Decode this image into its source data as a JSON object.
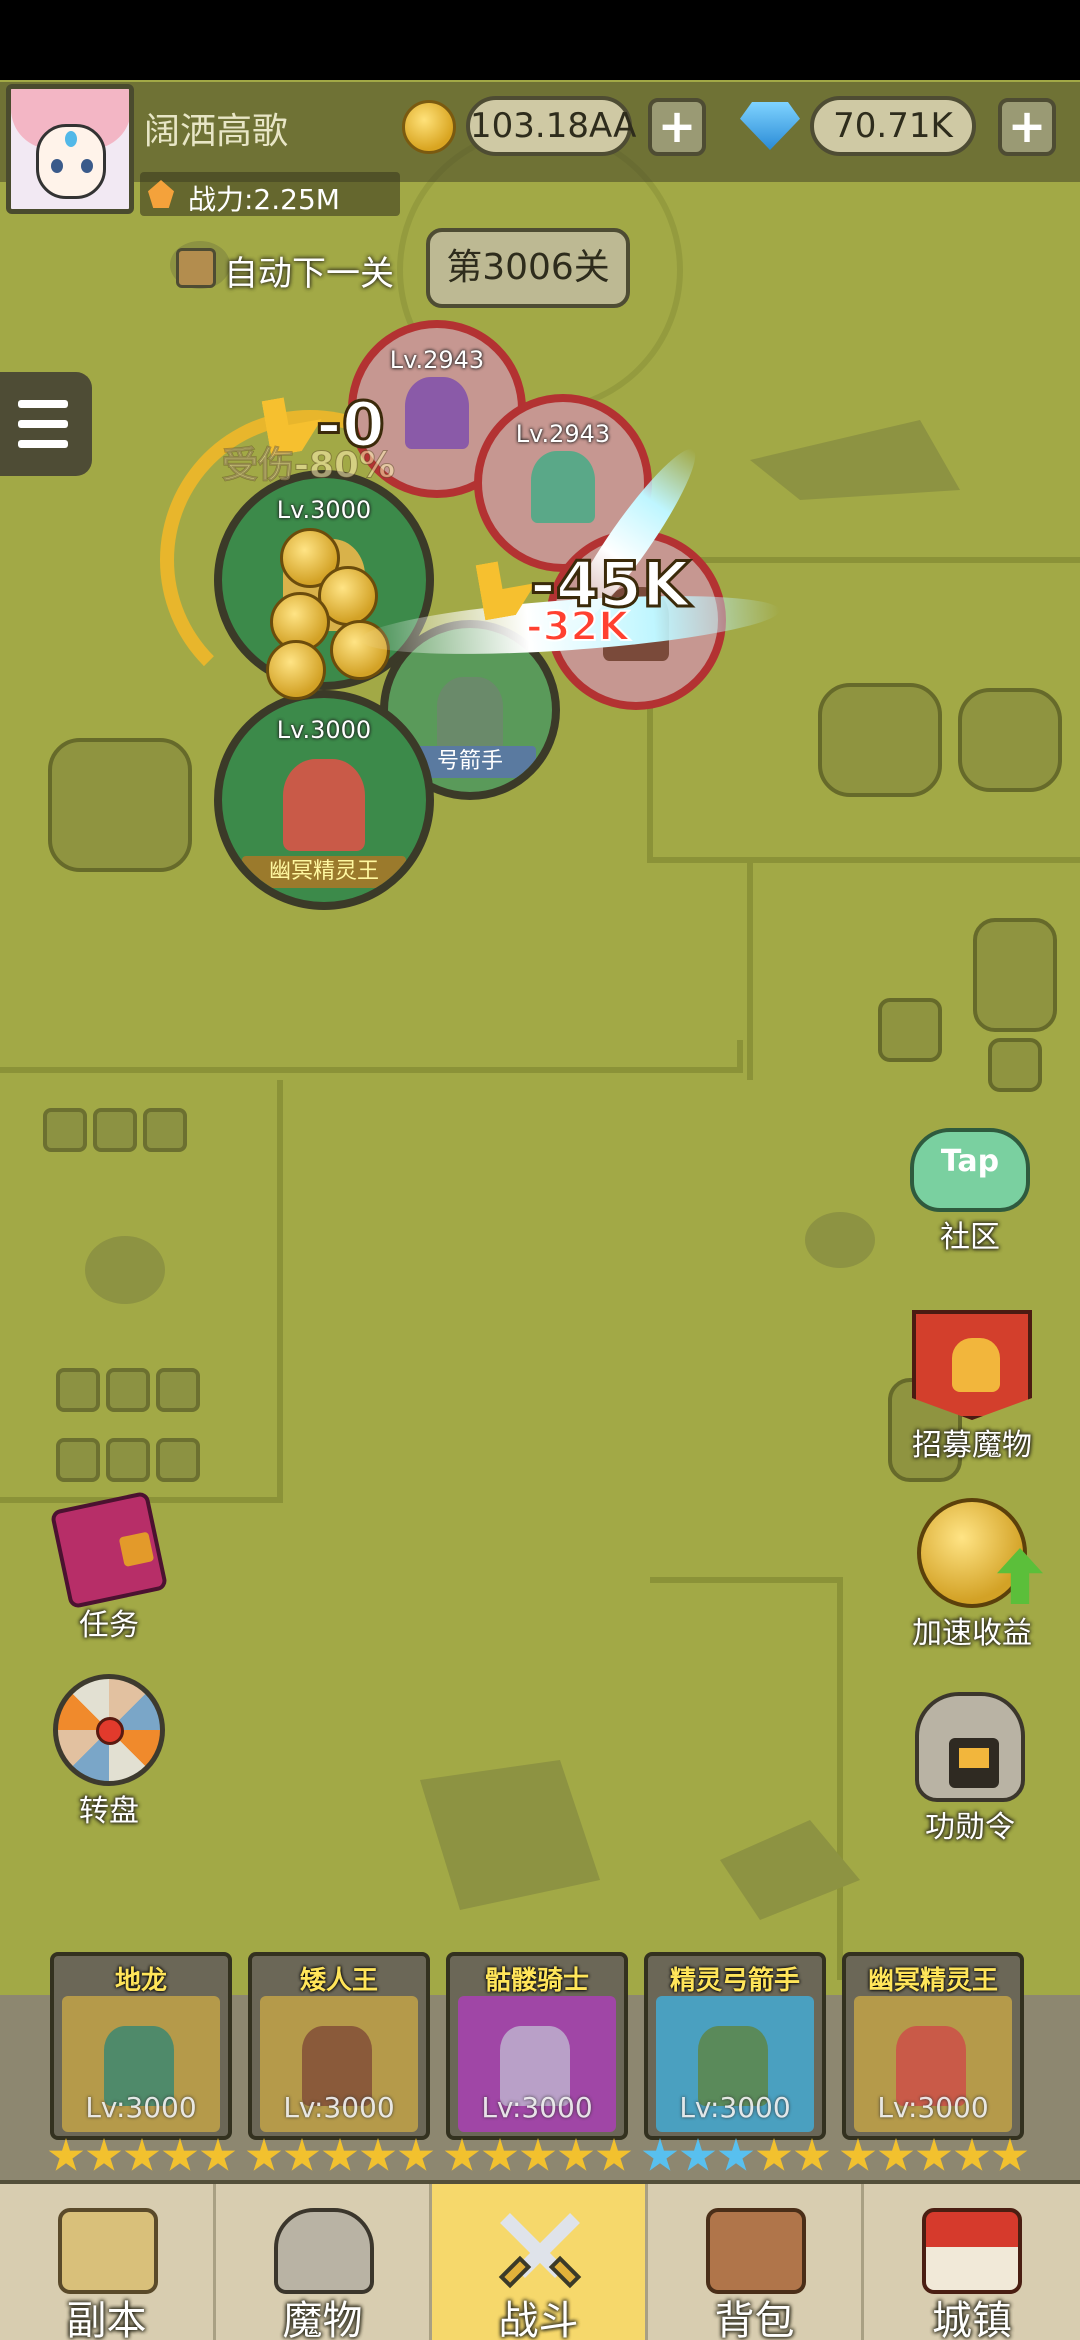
{
  "player": {
    "name": "阔洒高歌",
    "power_label": "战力:2.25M"
  },
  "resources": {
    "gold": "103.18AA",
    "gems": "70.71K",
    "plus_label": "+"
  },
  "stage": {
    "auto_next_label": "自动下一关",
    "level_label": "第3006关"
  },
  "battle": {
    "allies": [
      {
        "level": "Lv.3000"
      },
      {
        "level": "Lv.3000",
        "name": "幽冥精灵王"
      }
    ],
    "enemies": [
      {
        "level": "Lv.2943"
      },
      {
        "level": "Lv.2943"
      }
    ],
    "partial_label": "号箭手",
    "damage_numbers": [
      "-0",
      "-45K",
      "-32K"
    ],
    "debuff_text": "受伤-80%"
  },
  "side_buttons": {
    "community": {
      "label": "社区",
      "icon": "tap-cloud-icon",
      "icon_text": "Tap"
    },
    "recruit": {
      "label": "招募魔物",
      "icon": "recruit-banner-icon"
    },
    "boost": {
      "label": "加速收益",
      "icon": "coin-boost-icon"
    },
    "merit": {
      "label": "功勋令",
      "icon": "helmet-icon"
    },
    "tasks": {
      "label": "任务",
      "icon": "book-icon"
    },
    "wheel": {
      "label": "转盘",
      "icon": "wheel-icon"
    }
  },
  "heroes": [
    {
      "name": "地龙",
      "level": "Lv:3000",
      "stars": 5,
      "star_color": "gold",
      "bg": "#b59a4a",
      "body": "#4f8a6a"
    },
    {
      "name": "矮人王",
      "level": "Lv:3000",
      "stars": 5,
      "star_color": "gold",
      "bg": "#b59a4a",
      "body": "#8a5a3a"
    },
    {
      "name": "骷髅骑士",
      "level": "Lv:3000",
      "stars": 5,
      "star_color": "gold",
      "bg": "#a046a6",
      "body": "#b9a0c8"
    },
    {
      "name": "精灵弓箭手",
      "level": "Lv:3000",
      "stars": 5,
      "star_color": "blue3",
      "bg": "#4aa0c0",
      "body": "#5a8a5a"
    },
    {
      "name": "幽冥精灵王",
      "level": "Lv:3000",
      "stars": 5,
      "star_color": "gold",
      "bg": "#b59a4a",
      "body": "#c95a48"
    }
  ],
  "nav": [
    {
      "label": "副本",
      "icon": "map-scroll-icon",
      "active": false
    },
    {
      "label": "魔物",
      "icon": "monster-helmet-icon",
      "active": false
    },
    {
      "label": "战斗",
      "icon": "crossed-swords-icon",
      "active": true
    },
    {
      "label": "背包",
      "icon": "backpack-icon",
      "active": false
    },
    {
      "label": "城镇",
      "icon": "town-shop-icon",
      "active": false
    }
  ]
}
